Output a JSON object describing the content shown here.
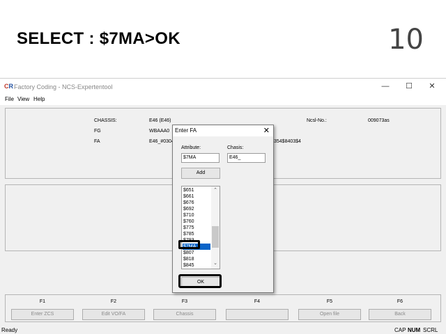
{
  "slide": {
    "title": "SELECT : $7MA>OK",
    "page_number": "10"
  },
  "window": {
    "title": "Factory Coding - NCS-Expertentool",
    "icon_text_a": "C",
    "icon_text_b": "R",
    "minimize": "—",
    "maximize": "☐",
    "close": "✕"
  },
  "menu": [
    "File",
    "View",
    "Help"
  ],
  "info": {
    "chassis_label": "CHASSIS:",
    "chassis_value": "E46 (E46)",
    "fg_label": "FG",
    "fg_value": "WBAAA0",
    "fa_label": "FA",
    "fa_value": "E46_#0304",
    "fa_value_tail": "354$8403$4",
    "ncsl_label": "Ncsl-No.:",
    "ncsl_value": "009073as"
  },
  "fkeys": [
    {
      "key": "F1",
      "label": "Enter ZCS"
    },
    {
      "key": "F2",
      "label": "Edit VO/FA"
    },
    {
      "key": "F3",
      "label": "Chassis"
    },
    {
      "key": "F4",
      "label": ""
    },
    {
      "key": "F5",
      "label": "Open file"
    },
    {
      "key": "F6",
      "label": "Back"
    }
  ],
  "status": {
    "text": "Ready",
    "cap": "CAP",
    "num": "NUM",
    "scrl": "SCRL"
  },
  "dialog": {
    "title": "Enter FA",
    "close": "✕",
    "attribute_label": "Attribute:",
    "attribute_value": "$7MA",
    "chassis_label": "Chasis:",
    "chassis_value": "E46_",
    "add_label": "Add",
    "ok_label": "OK",
    "list": [
      "$651",
      "$661",
      "$676",
      "$692",
      "$710",
      "$760",
      "$775",
      "$785",
      "$793",
      "$7MA",
      "$807",
      "$818",
      "$845"
    ],
    "selected": "$7MA",
    "scroll_up": "⌃",
    "scroll_down": "⌄"
  },
  "colors": {
    "selection": "#0a64c8",
    "window_bg": "#f0f0f0"
  }
}
